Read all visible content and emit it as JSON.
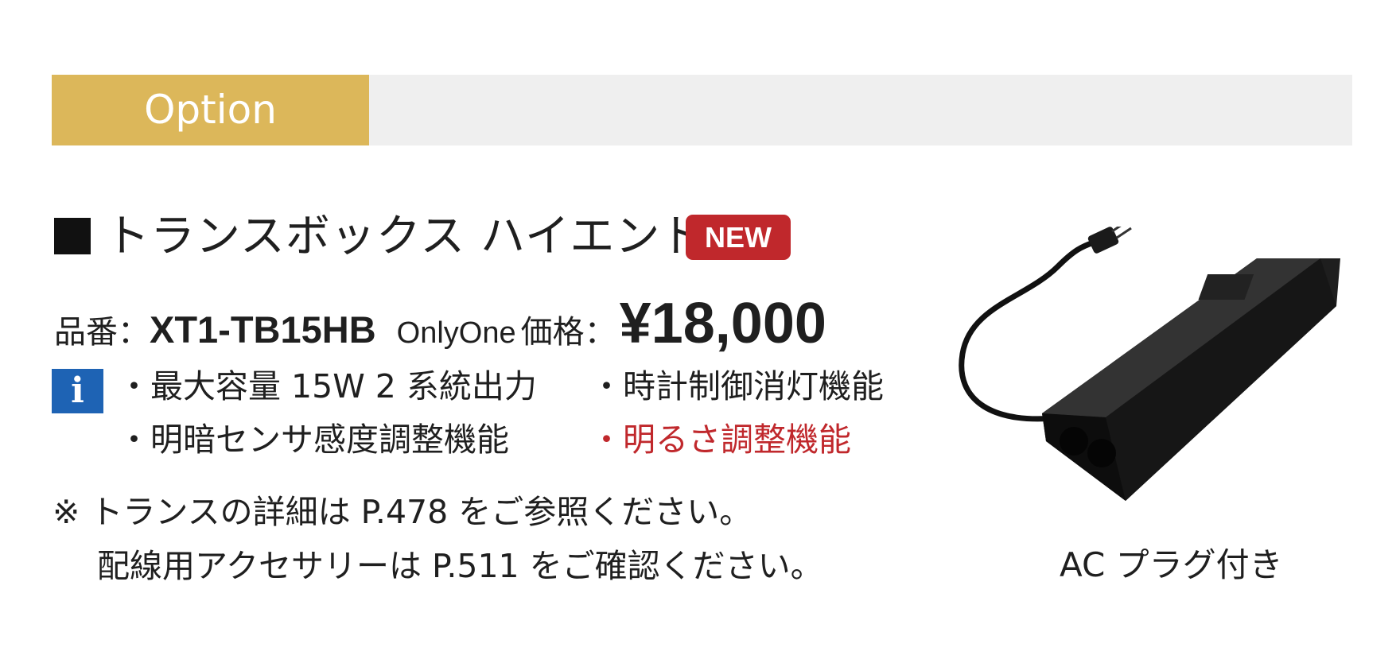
{
  "banner": {
    "label": "Option",
    "accent_color": "#dcb75a",
    "bar_color": "#efefef"
  },
  "product": {
    "title": "トランスボックス ハイエンド",
    "badge": "NEW",
    "part_number_label": "品番：",
    "part_number": "XT1-TB15HB",
    "price_label_latin": "OnlyOne",
    "price_label": "価格：",
    "price": "¥18,000",
    "info_icon": "info-icon",
    "features": [
      "・最大容量 15W  2 系統出力",
      "・時計制御消灯機能",
      "・明暗センサ感度調整機能",
      "・明るさ調整機能"
    ],
    "highlight_color": "#c0282c",
    "notes": [
      "※ トランスの詳細は P.478 をご参照ください。",
      "配線用アクセサリーは P.511 をご確認ください。"
    ],
    "image_caption": "AC プラグ付き"
  }
}
